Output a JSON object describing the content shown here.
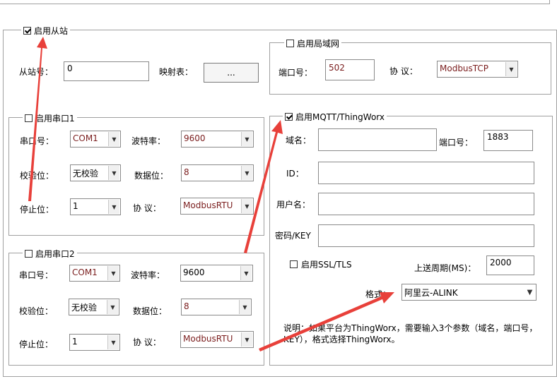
{
  "slave": {
    "enable_label": "启用从站",
    "enabled": true,
    "station_no_label": "从站号：",
    "station_no_value": "0",
    "mapping_label": "映射表：",
    "mapping_button": "..."
  },
  "lan": {
    "enable_label": "启用局域网",
    "enabled": false,
    "port_label": "端口号：",
    "port_value": "502",
    "protocol_label": "协  议：",
    "protocol_value": "ModbusTCP"
  },
  "serial1": {
    "enable_label": "启用串口1",
    "enabled": false,
    "port_label": "串口号：",
    "port_value": "COM1",
    "baud_label": "波特率：",
    "baud_value": "9600",
    "parity_label": "校验位：",
    "parity_value": "无校验",
    "databits_label": "数据位：",
    "databits_value": "8",
    "stopbits_label": "停止位：",
    "stopbits_value": "1",
    "protocol_label": "协  议：",
    "protocol_value": "ModbusRTU"
  },
  "serial2": {
    "enable_label": "启用串口2",
    "enabled": false,
    "port_label": "串口号：",
    "port_value": "COM1",
    "baud_label": "波特率：",
    "baud_value": "9600",
    "parity_label": "校验位：",
    "parity_value": "无校验",
    "databits_label": "数据位：",
    "databits_value": "8",
    "stopbits_label": "停止位：",
    "stopbits_value": "1",
    "protocol_label": "协  议：",
    "protocol_value": "ModbusRTU"
  },
  "mqtt": {
    "enable_label": "启用MQTT/ThingWorx",
    "enabled": true,
    "domain_label": "域名：",
    "domain_value": "",
    "port_label": "端口号：",
    "port_value": "1883",
    "id_label": "ID：",
    "id_value": "",
    "username_label": "用户名：",
    "username_value": "",
    "password_label": "密码/KEY",
    "password_value": "",
    "ssl_label": "启用SSL/TLS",
    "ssl_enabled": false,
    "period_label": "上送周期(MS)：",
    "period_value": "2000",
    "format_label": "格式：",
    "format_value": "阿里云-ALINK",
    "note_line1": "说明：如果平台为ThingWorx，需要输入3个参数（域名，端口号，",
    "note_line2": "KEY），格式选择ThingWorx。"
  },
  "colors": {
    "arrow": "#e8403a",
    "field_text": "#7a1d1d",
    "frame": "#a0a0a0"
  }
}
